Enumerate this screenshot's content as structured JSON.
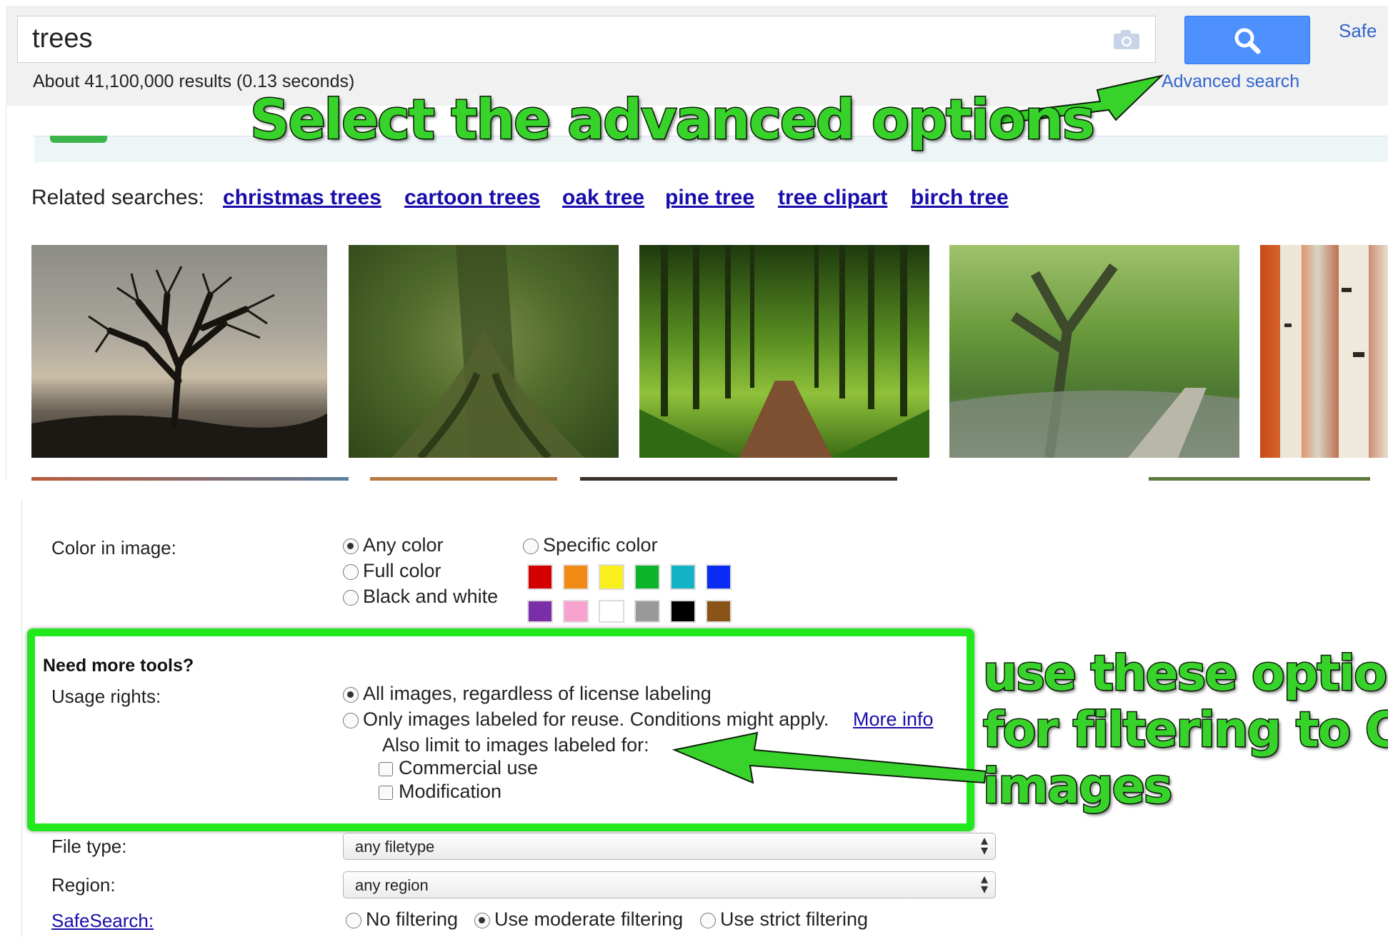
{
  "search": {
    "query": "trees",
    "result_stats": "About 41,100,000 results (0.13 seconds)",
    "advanced_search": "Advanced search",
    "safe_link": "Safe"
  },
  "related": {
    "label": "Related searches:",
    "links": [
      "christmas trees",
      "cartoon trees",
      "oak tree",
      "pine tree",
      "tree clipart",
      "birch tree"
    ]
  },
  "annotations": {
    "top_callout": "Select the advanced options",
    "side_callout_lines": [
      "use these options",
      "for filtering to CC",
      "images"
    ]
  },
  "color": {
    "label": "Color in image:",
    "options": [
      "Any color",
      "Full color",
      "Black and white"
    ],
    "selected": "Any color",
    "specific": "Specific color",
    "swatches": [
      "#d40000",
      "#f28a16",
      "#f9ef1e",
      "#0ab52a",
      "#13b2c4",
      "#0b2bf5",
      "#7a2ea8",
      "#f8a3cf",
      "#ffffff",
      "#999999",
      "#000000",
      "#8a5418"
    ]
  },
  "usage": {
    "heading": "Need more tools?",
    "label": "Usage rights:",
    "options": [
      "All images, regardless of license labeling",
      "Only images labeled for reuse. Conditions might apply."
    ],
    "more_info": "More info",
    "also_limit": "Also limit to images labeled for:",
    "checks": [
      "Commercial use",
      "Modification"
    ]
  },
  "filetype": {
    "label": "File type:",
    "value": "any filetype"
  },
  "region": {
    "label": "Region:",
    "value": "any region"
  },
  "safesearch": {
    "label": "SafeSearch:",
    "options": [
      "No filtering",
      "Use moderate filtering",
      "Use strict filtering"
    ],
    "selected": "Use moderate filtering"
  },
  "colors": {
    "highlight_green": "#22e81e",
    "button_blue": "#4d90fe",
    "link_blue": "#1a0dab"
  }
}
